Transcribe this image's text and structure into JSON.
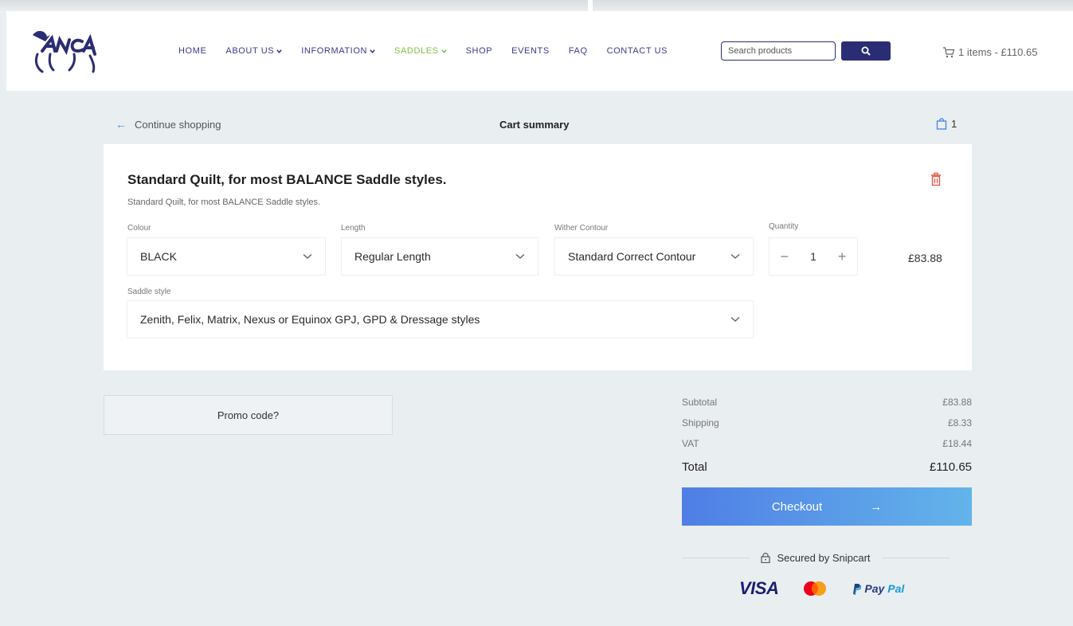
{
  "header": {
    "logo_alt": "ANCA",
    "nav": [
      {
        "label": "HOME",
        "dropdown": false,
        "active": false
      },
      {
        "label": "ABOUT US",
        "dropdown": true,
        "active": false
      },
      {
        "label": "INFORMATION",
        "dropdown": true,
        "active": false
      },
      {
        "label": "SADDLES",
        "dropdown": true,
        "active": true
      },
      {
        "label": "SHOP",
        "dropdown": false,
        "active": false
      },
      {
        "label": "EVENTS",
        "dropdown": false,
        "active": false
      },
      {
        "label": "FAQ",
        "dropdown": false,
        "active": false
      },
      {
        "label": "CONTACT US",
        "dropdown": false,
        "active": false
      }
    ],
    "search_placeholder": "Search products",
    "cart_summary": "1 items - £110.65"
  },
  "subbar": {
    "continue_label": "Continue shopping",
    "title": "Cart summary",
    "bag_count": "1"
  },
  "item": {
    "title": "Standard Quilt, for most BALANCE Saddle styles.",
    "description": "Standard Quilt, for most BALANCE Saddle styles.",
    "colour_label": "Colour",
    "colour_value": "BLACK",
    "length_label": "Length",
    "length_value": "Regular Length",
    "wither_label": "Wither Contour",
    "wither_value": "Standard Correct Contour",
    "quantity_label": "Quantity",
    "quantity_value": "1",
    "price": "£83.88",
    "saddle_label": "Saddle style",
    "saddle_value": "Zenith, Felix, Matrix, Nexus or Equinox GPJ, GPD & Dressage styles"
  },
  "promo_label": "Promo code?",
  "totals": {
    "subtotal_label": "Subtotal",
    "subtotal": "£83.88",
    "shipping_label": "Shipping",
    "shipping": "£8.33",
    "vat_label": "VAT",
    "vat": "£18.44",
    "total_label": "Total",
    "total": "£110.65"
  },
  "checkout_label": "Checkout",
  "secured_label": "Secured by Snipcart",
  "payment": {
    "visa": "VISA",
    "paypal_a": "Pay",
    "paypal_b": "Pal"
  },
  "colors": {
    "brand_navy": "#2b2d74",
    "nav_active": "#7cc241",
    "checkout_start": "#4f7ee6",
    "checkout_end": "#63b4ea",
    "trash": "#e05a4a"
  }
}
